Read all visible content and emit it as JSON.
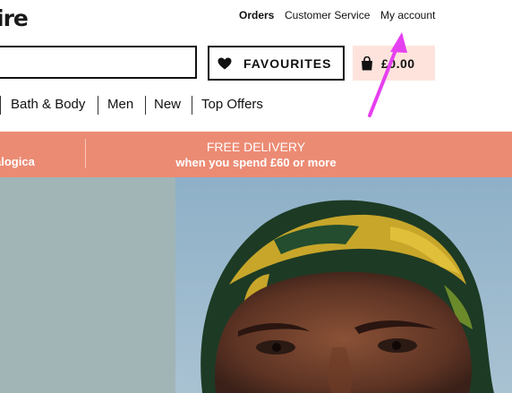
{
  "brand": {
    "logo_fragment": "ire"
  },
  "top_links": {
    "orders": "Orders",
    "customer_service": "Customer Service",
    "my_account": "My account"
  },
  "search": {
    "value": "",
    "placeholder": ""
  },
  "favourites": {
    "label": "FAVOURITES",
    "icon": "heart-icon"
  },
  "basket": {
    "total": "£0.00",
    "icon": "shopping-bag-icon"
  },
  "nav": {
    "items": [
      "Bath & Body",
      "Men",
      "New",
      "Top Offers"
    ]
  },
  "promo": {
    "left_text": "alogica",
    "line1": "FREE DELIVERY",
    "line2": "when you spend £60 or more"
  },
  "colors": {
    "banner": "#ec8b74",
    "basket_bg": "#fde3dc",
    "hero_panel": "#a1b5b7",
    "annotation_arrow": "#e63ff0"
  }
}
